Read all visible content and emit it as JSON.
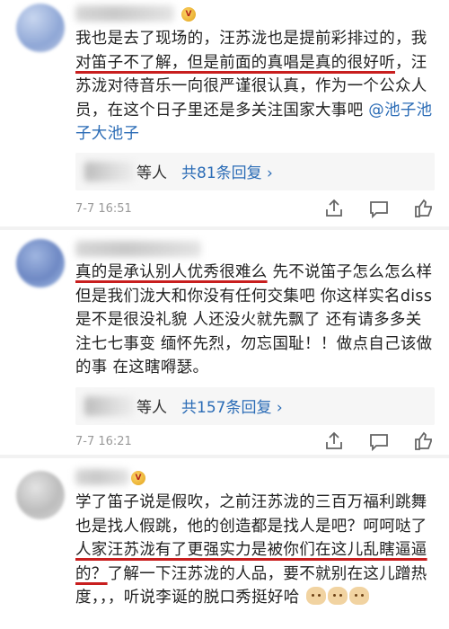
{
  "comments": [
    {
      "text_a": "我也是去了现场的，汪苏泷也是提前彩排过的，我",
      "text_hl": "对笛子不了解，但是前面的真唱是真的很好听",
      "text_b": "，汪苏泷对待音乐一向很严谨很认真，作为一个公众人员，在这个日子里还是多关注国家大事吧 ",
      "mention": "@池子池子大池子",
      "reply_who": "等人",
      "reply_count": "共81条回复 ›",
      "time": "7-7 16:51",
      "vip_badge": "V"
    },
    {
      "text_hl": "真的是承认别人优秀很难么",
      "text_b": " 先不说笛子怎么怎么样 但是我们泷大和你没有任何交集吧 你这样实名diss是不是很没礼貌 人还没火就先飘了 还有请多多关注七七事变 缅怀先烈，勿忘国耻！！做点自己该做的事 在这瞎嘚瑟。",
      "reply_who": "等人",
      "reply_count": "共157条回复 ›",
      "time": "7-7 16:21"
    },
    {
      "text_a": "学了笛子说是假吹，之前汪苏泷的三百万福利跳舞也是找人假跳，他的创造都是找人是吧？呵呵哒了",
      "text_hl": "人家汪苏泷有了更强实力是被你们在这儿乱瞎逼逼的？",
      "text_b": "了解一下汪苏泷的人品，要不就别在这儿蹭热度，，，听说李诞的脱口秀挺好哈",
      "vip_badge": "V"
    }
  ],
  "icons": [
    "share-icon",
    "comment-icon",
    "like-icon"
  ],
  "colors": {
    "underline": "#c81e1e",
    "link": "#2b6cb6",
    "separator": "#f2f2f2"
  }
}
